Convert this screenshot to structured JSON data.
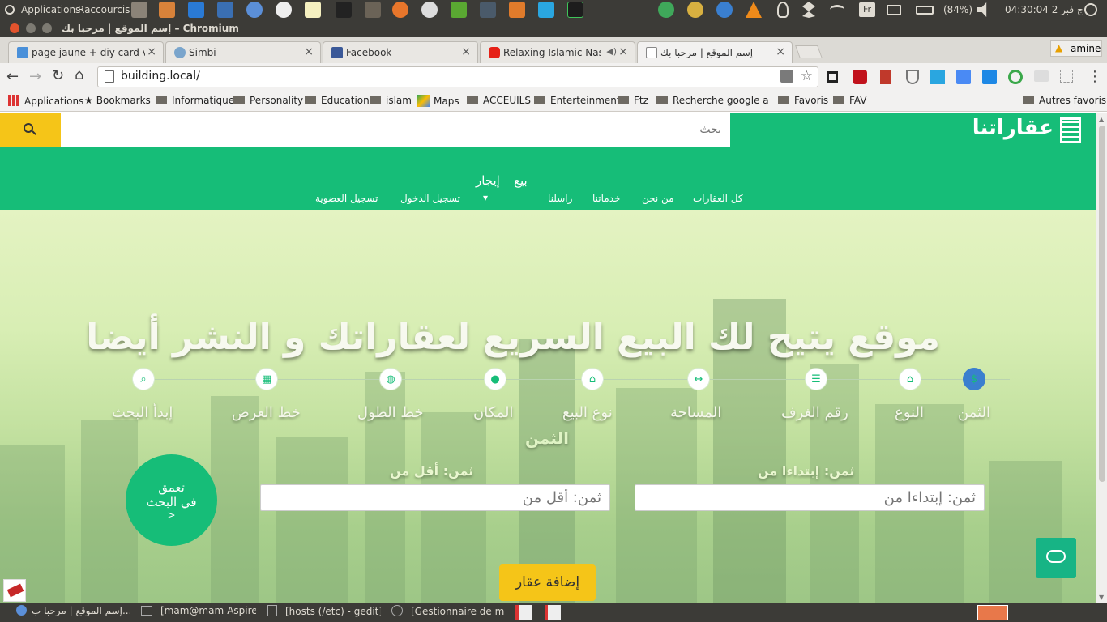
{
  "system_panel": {
    "menu_applications": "Applications",
    "menu_shortcuts": "Raccourcis",
    "battery": "(84%)",
    "clock": "04:30:04 2 ج فبر",
    "user": "amine",
    "keyboard_layout": "Fr"
  },
  "window": {
    "title": "إسم الموقع | مرحبا بك – Chromium"
  },
  "tabs": [
    {
      "label": "page jaune + diy card v + w",
      "favicon_color": "#4a90d9"
    },
    {
      "label": "Simbi",
      "favicon_color": "#7aa5cc"
    },
    {
      "label": "Facebook",
      "favicon_color": "#3b5998"
    },
    {
      "label": "Relaxing Islamic Nashe",
      "favicon_color": "#e62117"
    },
    {
      "label": "إسم الموقع | مرحبا بك",
      "favicon_color": "#888888"
    }
  ],
  "address_bar": {
    "url": "building.local/"
  },
  "bookmarks": [
    "Applications",
    "Bookmarks",
    "Informatique",
    "Personality",
    "Education",
    "islam",
    "Maps",
    "ACCEUILS",
    "Enterteinment",
    "Ftz",
    "Recherche google a tr",
    "Favoris",
    "FAV"
  ],
  "bookmarks_other": "Autres favoris",
  "site": {
    "search_placeholder": "بحث",
    "logo_text": "عقاراتنا",
    "tabs": {
      "sell": "بيع",
      "rent": "إيجار"
    },
    "nav": [
      "كل العقارات",
      "من نحن",
      "خدماتنا",
      "راسلنا",
      "▾",
      "تسجيل الدخول",
      "تسجيل العضوية"
    ],
    "hero_title": "موقع يتيح لك البيع السريع لعقاراتك و النشر أيضا",
    "steps": [
      {
        "label": "الثمن",
        "icon": "dollar-icon",
        "glyph": "$"
      },
      {
        "label": "النوع",
        "icon": "basket-icon",
        "glyph": "⌂"
      },
      {
        "label": "رقم الغرف",
        "icon": "list-icon",
        "glyph": "☰"
      },
      {
        "label": "المساحة",
        "icon": "arrows-horizontal-icon",
        "glyph": "↔"
      },
      {
        "label": "نوع البيع",
        "icon": "home-icon",
        "glyph": "⌂"
      },
      {
        "label": "المكان",
        "icon": "map-marker-icon",
        "glyph": "●"
      },
      {
        "label": "خط الطول",
        "icon": "globe-icon",
        "glyph": "◍"
      },
      {
        "label": "خط العرض",
        "icon": "map-icon",
        "glyph": "▦"
      },
      {
        "label": "إبدأ البحث",
        "icon": "search-icon",
        "glyph": "⌕"
      }
    ],
    "section_title": "الثمن",
    "price_from_label": "ثمن: إبتداءا من",
    "price_from_placeholder": "ثمن: إبتداءا من",
    "price_to_label": "ثمن: أقل من",
    "price_to_placeholder": "ثمن: أقل من",
    "deep_search": {
      "line1": "تعمق",
      "line2": "في البحث",
      "line3": ">"
    },
    "add_property": "إضافة عقار",
    "accent_green": "#16bd78",
    "accent_yellow": "#f5c518"
  },
  "taskbar": [
    "إسم الموقع | مرحبا ب...",
    "[mam@mam-Aspire...",
    "[hosts (/etc) - gedit]",
    "[Gestionnaire de mi..."
  ]
}
